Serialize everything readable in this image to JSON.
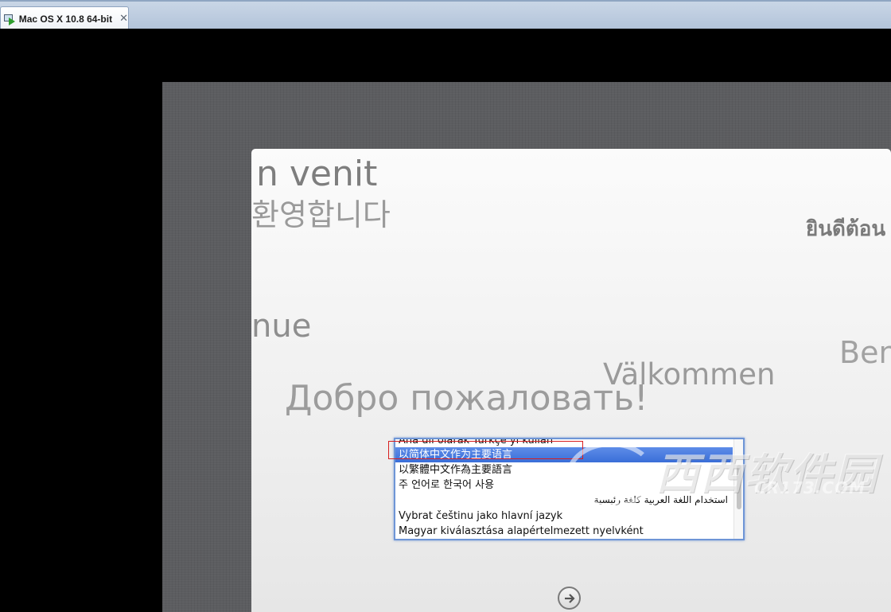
{
  "tab": {
    "title": "Mac OS X 10.8 64-bit",
    "close_glyph": "✕",
    "icon": "vm-play-icon"
  },
  "welcome_words": [
    "n venit",
    "환영합니다",
    "ยินดีต้อน",
    "nue",
    "Ben",
    "Välkommen",
    "Добро пожаловать!"
  ],
  "language_list": {
    "items": [
      "Ana dil olarak Türkçe’yi kullan",
      "以简体中文作为主要语言",
      "以繁體中文作為主要語言",
      "주 언어로 한국어 사용",
      "استخدام اللغة العربية كلغة رئيسية",
      "Vybrat češtinu jako hlavní jazyk",
      "Magyar kiválasztása alapértelmezett nyelvként"
    ],
    "selected_index": 1
  },
  "continue_button": {
    "icon": "arrow-right-circle-icon"
  },
  "watermark": {
    "main": "西西软件园",
    "sub": "CR173.COM"
  },
  "colors": {
    "selection": "#3a6ed8",
    "highlight_box": "#d81f1f",
    "list_border": "#6e95d6"
  }
}
